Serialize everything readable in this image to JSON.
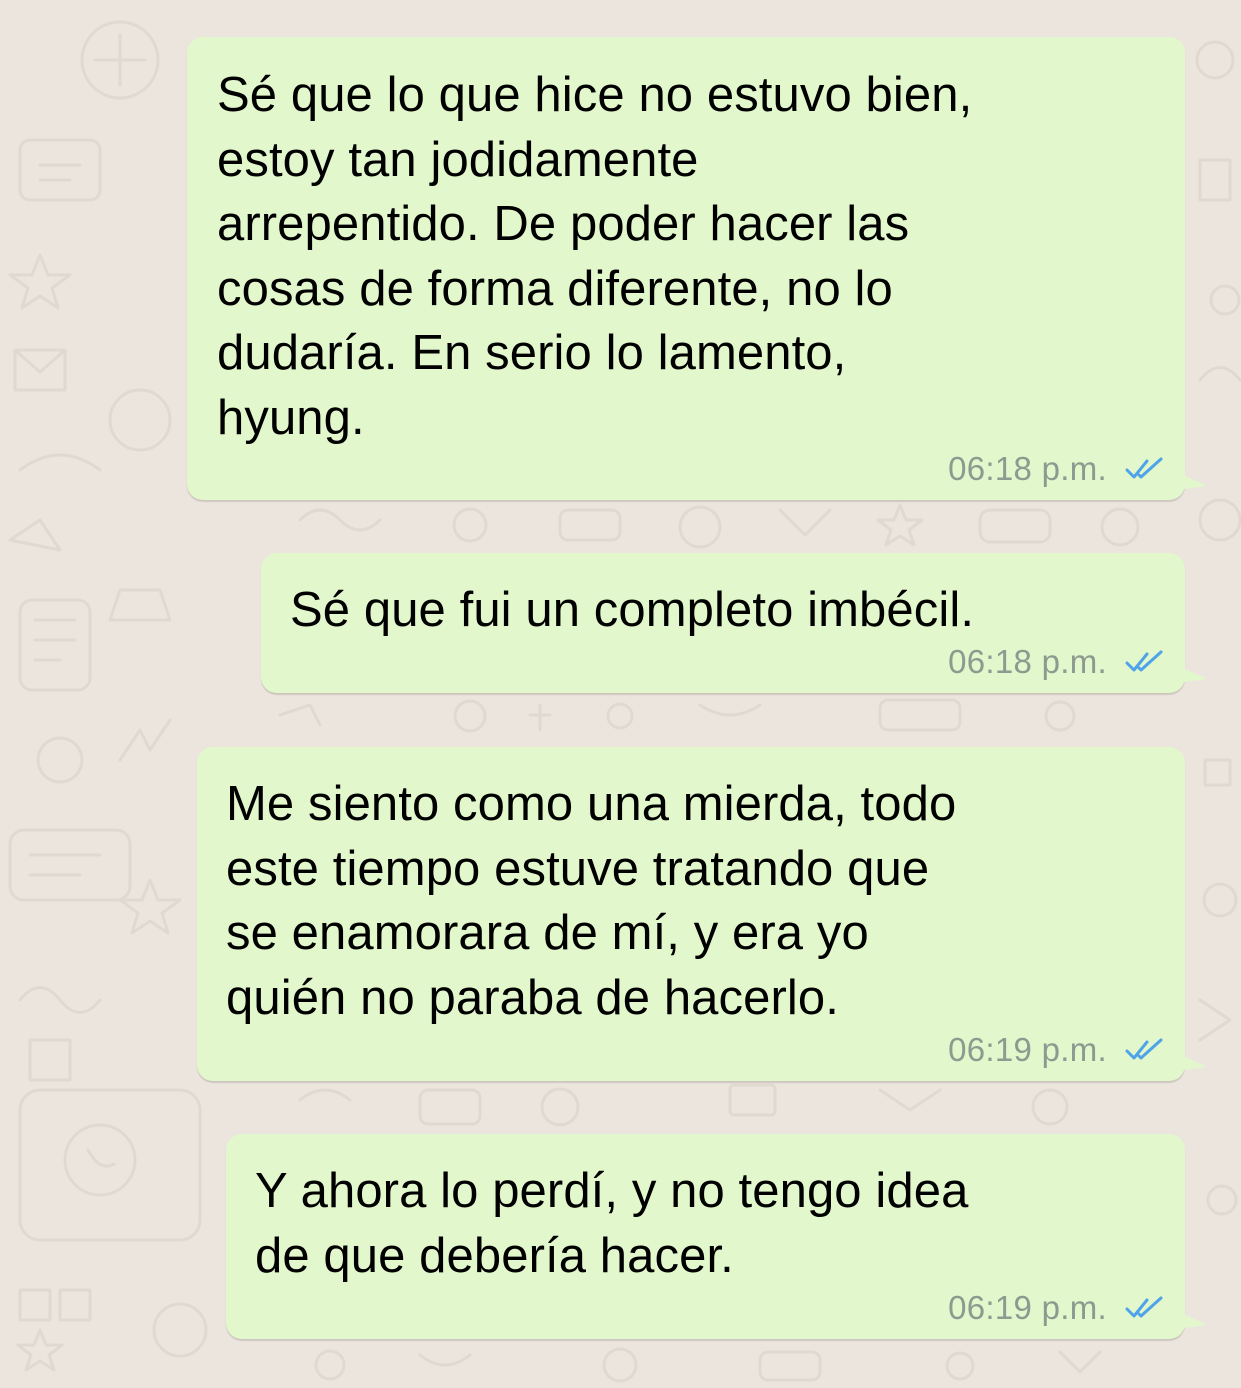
{
  "theme": {
    "background": "#ece5dd",
    "bubble_outgoing": "#e2f7cb",
    "timestamp_color": "#8c9a8f",
    "read_ticks_color": "#4fa3e8"
  },
  "messages": [
    {
      "text": "Sé que lo que hice no estuvo bien,\nestoy tan jodidamente\narrepentido. De poder hacer las\ncosas de forma diferente, no lo\ndudaría. En serio lo lamento,\nhyung.",
      "time": "06:18 p.m.",
      "status_icon": "double-check-read-icon"
    },
    {
      "text": "Sé que fui un completo imbécil.",
      "time": "06:18 p.m.",
      "status_icon": "double-check-read-icon"
    },
    {
      "text": "Me siento como una mierda, todo\neste tiempo estuve tratando que\nse enamorara de mí, y era yo\nquién no paraba de hacerlo.",
      "time": "06:19 p.m.",
      "status_icon": "double-check-read-icon"
    },
    {
      "text": "Y ahora lo perdí, y no tengo idea\nde que debería hacer.",
      "time": "06:19 p.m.",
      "status_icon": "double-check-read-icon"
    }
  ]
}
